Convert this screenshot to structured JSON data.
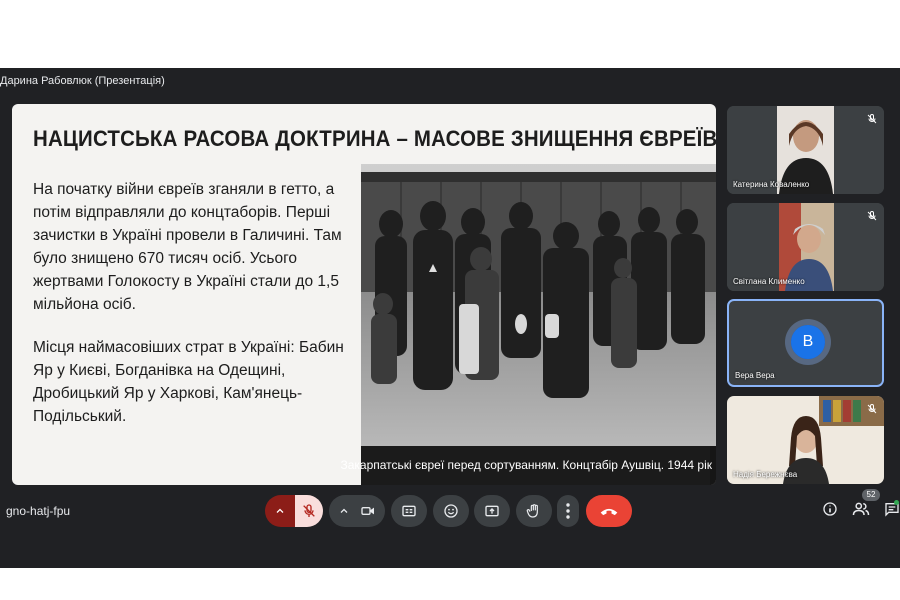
{
  "presenter": {
    "label": "Дарина Рабовлюк (Презентація)"
  },
  "slide": {
    "title": "НАЦИСТСЬКА РАСОВА ДОКТРИНА – МАСОВЕ ЗНИЩЕННЯ ЄВРЕЇВ",
    "paragraph1": "На початку війни євреїв зганяли в гетто, а потім відправляли до концтаборів. Перші зачистки в Україні провели в Галичині. Там було знищено 670 тисяч осіб. Усього жертвами Голокосту в Україні стали до 1,5 мільйона осіб.",
    "paragraph2": "Місця наймасовіших страт в Україні: Бабин Яр у Києві, Богданівка на Одещині, Дробицький Яр у Харкові, Кам'янець-Подільський.",
    "caption": "Закарпатські євреї перед сортуванням. Концтабір Аушвіц. 1944 рік"
  },
  "participants": [
    {
      "name": "Катерина Коваленко",
      "muted": true
    },
    {
      "name": "Світлана Клименко",
      "muted": true
    },
    {
      "name": "Вера Вера",
      "avatar_letter": "В",
      "speaking": true
    },
    {
      "name": "Надія Бережнєва",
      "muted": true
    }
  ],
  "meeting": {
    "code": "gno-hatj-fpu"
  },
  "controls": [
    {
      "icon": "chevron-up-icon"
    },
    {
      "icon": "mic-off-icon",
      "state": "muted"
    },
    {
      "icon": "chevron-up-icon"
    },
    {
      "icon": "camera-off-icon"
    },
    {
      "icon": "captions-icon"
    },
    {
      "icon": "emoji-icon"
    },
    {
      "icon": "present-icon"
    },
    {
      "icon": "raise-hand-icon"
    },
    {
      "icon": "more-options-icon"
    },
    {
      "icon": "end-call-icon"
    }
  ],
  "side": {
    "info_icon": "info-icon",
    "people_icon": "people-icon",
    "people_count": "52",
    "chat_icon": "chat-icon"
  },
  "colors": {
    "end_call": "#ea4335",
    "muted_mic_bg": "#f9dedc",
    "active_tile_border": "#8ab4f8",
    "avatar": "#1a73e8"
  }
}
